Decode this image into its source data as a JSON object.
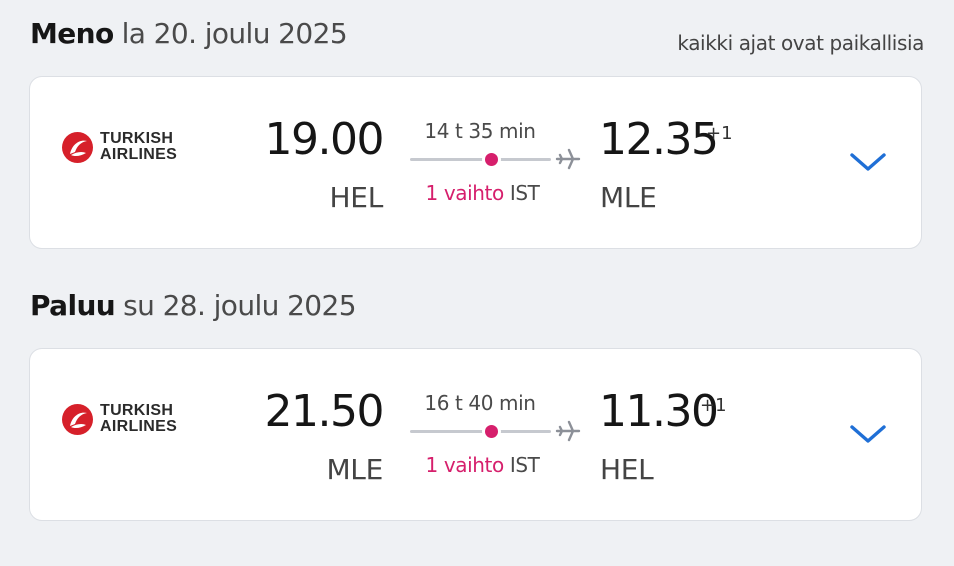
{
  "outbound": {
    "label": "Meno",
    "date": "la 20. joulu 2025",
    "note": "kaikki ajat ovat paikallisia",
    "airline": {
      "line1": "TURKISH",
      "line2": "AIRLINES",
      "icon": "turkish-airlines-logo"
    },
    "departure": {
      "time": "19.00",
      "airport": "HEL"
    },
    "duration": "14 t 35 min",
    "stops": "1 vaihto",
    "via": "IST",
    "arrival": {
      "time": "12.35",
      "day_offset": "+1",
      "airport": "MLE"
    },
    "expand_icon": "chevron-down-icon"
  },
  "return": {
    "label": "Paluu",
    "date": "su 28. joulu 2025",
    "airline": {
      "line1": "TURKISH",
      "line2": "AIRLINES",
      "icon": "turkish-airlines-logo"
    },
    "departure": {
      "time": "21.50",
      "airport": "MLE"
    },
    "duration": "16 t 40 min",
    "stops": "1 vaihto",
    "via": "IST",
    "arrival": {
      "time": "11.30",
      "day_offset": "+1",
      "airport": "HEL"
    },
    "expand_icon": "chevron-down-icon"
  },
  "colors": {
    "accent_stop": "#d61f6c",
    "chevron": "#1f6fd6",
    "airline_red": "#d6202a"
  }
}
